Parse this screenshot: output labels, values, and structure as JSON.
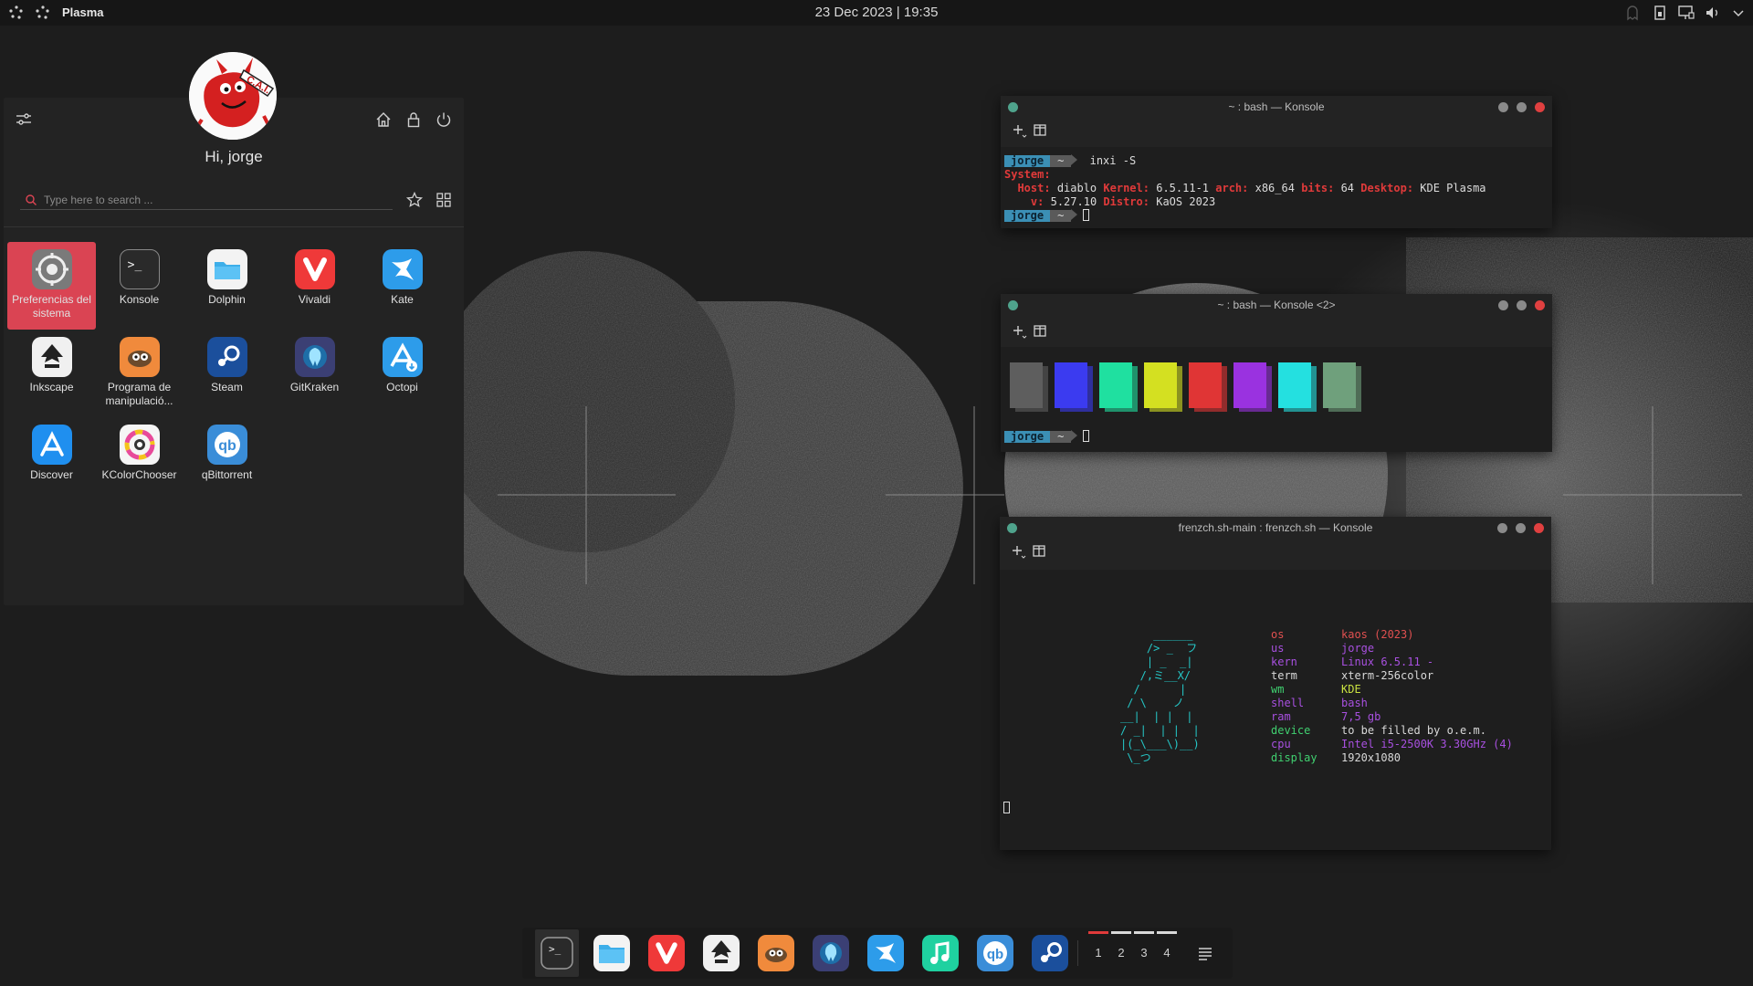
{
  "top_panel": {
    "panel_name": "Plasma",
    "clock": "23 Dec 2023 | 19:35"
  },
  "app_menu": {
    "greeting": "Hi, jorge",
    "search_placeholder": "Type here to search ...",
    "apps": [
      {
        "label": "Preferencias del sistema",
        "icon": "system-settings-icon",
        "color": "#6f6f6f",
        "active": true
      },
      {
        "label": "Konsole",
        "icon": "konsole-icon",
        "color": "#2a2a2a"
      },
      {
        "label": "Dolphin",
        "icon": "dolphin-icon",
        "color": "#f3f3f3"
      },
      {
        "label": "Vivaldi",
        "icon": "vivaldi-icon",
        "color": "#ef3939"
      },
      {
        "label": "Kate",
        "icon": "kate-icon",
        "color": "#2d9cea"
      },
      {
        "label": "Inkscape",
        "icon": "inkscape-icon",
        "color": "#f0f0f0"
      },
      {
        "label": "Programa de manipulació...",
        "icon": "gimp-icon",
        "color": "#f08a3c"
      },
      {
        "label": "Steam",
        "icon": "steam-icon",
        "color": "#1b4f9c"
      },
      {
        "label": "GitKraken",
        "icon": "gitkraken-icon",
        "color": "#3b3f74"
      },
      {
        "label": "Octopi",
        "icon": "octopi-icon",
        "color": "#2d9cea"
      },
      {
        "label": "Discover",
        "icon": "discover-icon",
        "color": "#1f8fef"
      },
      {
        "label": "KColorChooser",
        "icon": "kcolorchooser-icon",
        "color": "#f5f5f5"
      },
      {
        "label": "qBittorrent",
        "icon": "qbittorrent-icon",
        "color": "#3a8dd8"
      }
    ]
  },
  "konsole1": {
    "title": "~ : bash — Konsole",
    "user": "jorge",
    "tilde": "~",
    "command": "inxi -S",
    "system_label": "System:",
    "host_label": "Host:",
    "host": "diablo",
    "kernel_label": "Kernel:",
    "kernel": "6.5.11-1",
    "arch_label": "arch:",
    "arch": "x86_64",
    "bits_label": "bits:",
    "bits": "64",
    "desktop_label": "Desktop:",
    "desktop": "KDE Plasma",
    "v_label": "v:",
    "v": "5.27.10",
    "distro_label": "Distro:",
    "distro": "KaOS 2023"
  },
  "konsole2": {
    "title": "~ : bash — Konsole <2>",
    "user": "jorge",
    "tilde": "~",
    "swatches": [
      "#5e5e5e",
      "#3b3bf0",
      "#1fe0a0",
      "#d4e021",
      "#e03535",
      "#9a32e0",
      "#24e0e0",
      "#6fa07c"
    ]
  },
  "konsole3": {
    "title": "frenzch.sh-main : frenzch.sh — Konsole",
    "ascii_art": "     ______\n    /> _  フ\n    | _  _|\n   /,ミ__X/\n  /      |\n / \\    ノ\n__|  | |  |\n/ _|  | |  |\n|(_\\___\\)__)\n \\_つ",
    "info": [
      {
        "key": "os",
        "value": "kaos (2023)",
        "kcolor": "#e05050",
        "vcolor": "#e05050"
      },
      {
        "key": "us",
        "value": "jorge",
        "kcolor": "#a850e0",
        "vcolor": "#a850e0"
      },
      {
        "key": "kern",
        "value": "Linux 6.5.11 -",
        "kcolor": "#a850e0",
        "vcolor": "#a850e0"
      },
      {
        "key": "term",
        "value": "xterm-256color",
        "kcolor": "#d8d8d8",
        "vcolor": "#d8d8d8"
      },
      {
        "key": "wm",
        "value": "KDE",
        "kcolor": "#40d070",
        "vcolor": "#c8e040"
      },
      {
        "key": "shell",
        "value": "bash",
        "kcolor": "#a850e0",
        "vcolor": "#a850e0"
      },
      {
        "key": "ram",
        "value": "7,5 gb",
        "kcolor": "#a850e0",
        "vcolor": "#a850e0"
      },
      {
        "key": "device",
        "value": "to be filled by o.e.m.",
        "kcolor": "#40d070",
        "vcolor": "#d8d8d8"
      },
      {
        "key": "cpu",
        "value": "Intel i5-2500K 3.30GHz (4)",
        "kcolor": "#a850e0",
        "vcolor": "#a850e0"
      },
      {
        "key": "display",
        "value": "1920x1080",
        "kcolor": "#40d070",
        "vcolor": "#d8d8d8"
      }
    ]
  },
  "dock": {
    "items": [
      "konsole-icon",
      "dolphin-icon",
      "vivaldi-icon",
      "inkscape-icon",
      "gimp-icon",
      "gitkraken-icon",
      "kate-icon",
      "music-icon",
      "qbittorrent-icon",
      "steam-icon"
    ],
    "workspaces": [
      "1",
      "2",
      "3",
      "4"
    ]
  }
}
